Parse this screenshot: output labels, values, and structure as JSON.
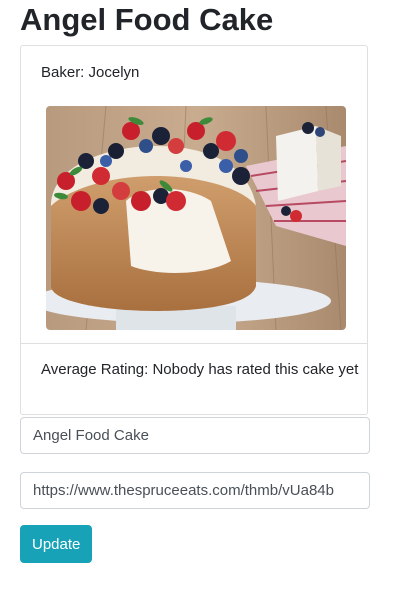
{
  "page": {
    "title": "Angel Food Cake"
  },
  "card": {
    "baker": "Baker: Jocelyn",
    "image_alt": "Angel Food Cake",
    "rating": "Average Rating: Nobody has rated this cake yet"
  },
  "form": {
    "name_value": "Angel Food Cake",
    "image_url_value": "https://www.thespruceeats.com/thmb/vUa84b",
    "update_label": "Update"
  },
  "colors": {
    "button": "#17a2b8",
    "border": "#dfdfdf"
  }
}
